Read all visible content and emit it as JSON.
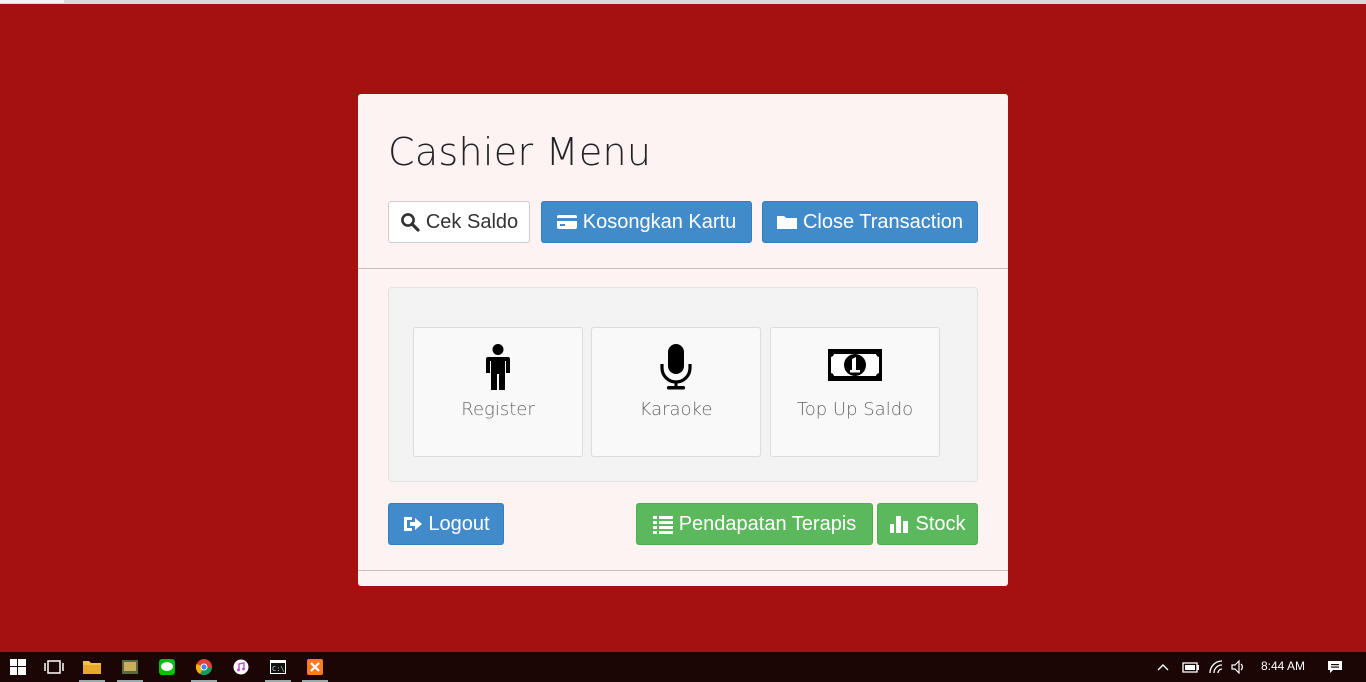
{
  "panel": {
    "title": "Cashier Menu",
    "toolbar": {
      "cek_saldo": "Cek Saldo",
      "kosongkan_kartu": "Kosongkan Kartu",
      "close_transaction": "Close Transaction"
    },
    "tiles": [
      {
        "label": "Register",
        "icon": "person-icon"
      },
      {
        "label": "Karaoke",
        "icon": "microphone-icon"
      },
      {
        "label": "Top Up Saldo",
        "icon": "money-icon"
      }
    ],
    "footer": {
      "logout": "Logout",
      "pendapatan_terapis": "Pendapatan Terapis",
      "stock": "Stock"
    }
  },
  "colors": {
    "background": "#a51111",
    "primary": "#428bca",
    "success": "#5cb85c",
    "panel": "#fdf3f2"
  },
  "taskbar": {
    "icons": [
      "windows-start-icon",
      "task-view-icon",
      "file-explorer-icon",
      "app-icon",
      "line-icon",
      "chrome-icon",
      "itunes-icon",
      "command-prompt-icon",
      "xampp-icon"
    ],
    "tray_icons": [
      "chevron-up-icon",
      "battery-icon",
      "wifi-icon",
      "volume-icon",
      "notification-icon"
    ],
    "clock": "8:44 AM"
  }
}
